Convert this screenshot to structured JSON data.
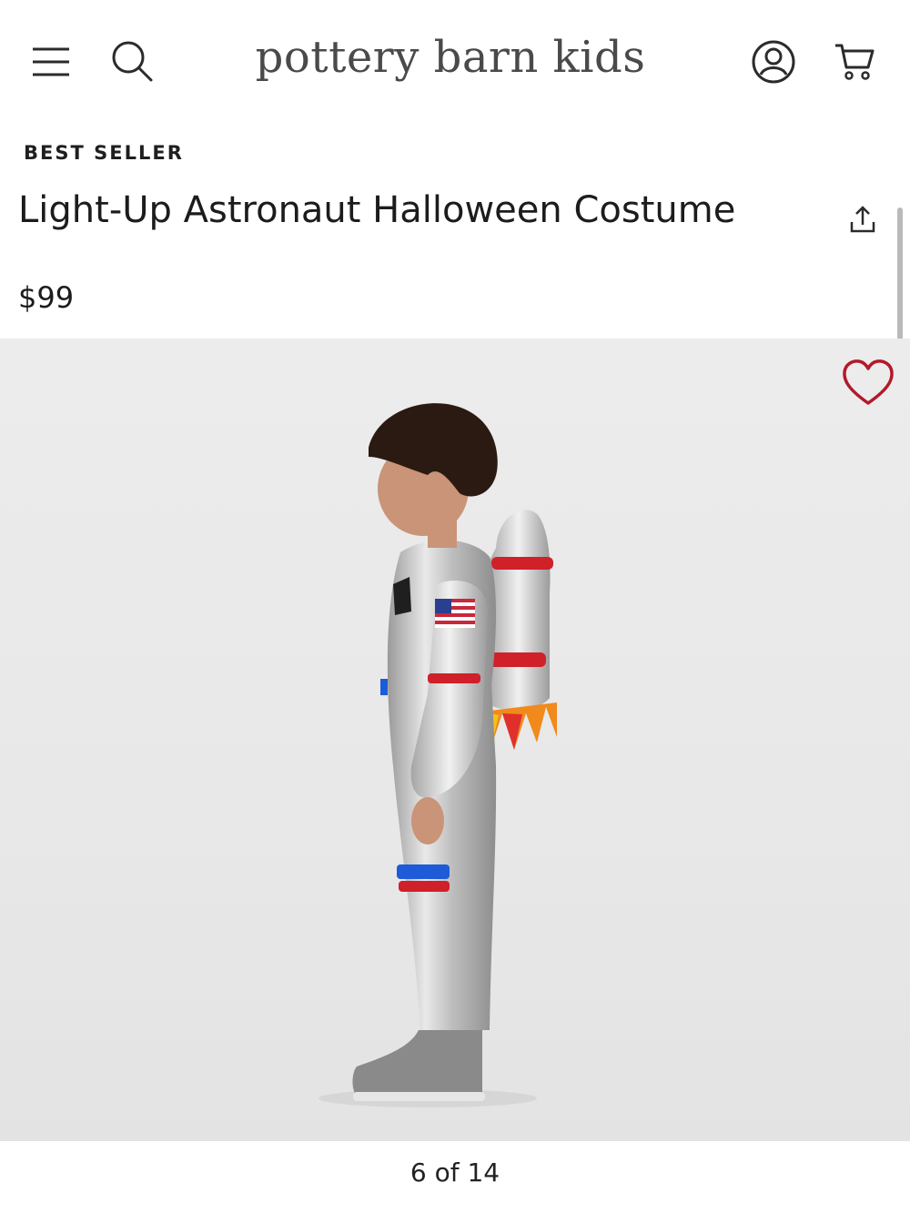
{
  "header": {
    "brand": "pottery barn kids",
    "icons": {
      "menu": "menu-icon",
      "search": "search-icon",
      "account": "account-icon",
      "cart": "cart-icon"
    }
  },
  "product": {
    "badge": "BEST SELLER",
    "title": "Light-Up Astronaut Halloween Costume",
    "price": "$99",
    "share_icon": "share-icon",
    "wishlist_icon": "heart-icon"
  },
  "gallery": {
    "counter": "6 of 14",
    "current": 6,
    "total": 14
  },
  "colors": {
    "heart": "#b3192b",
    "brand_text": "#4a4a4a",
    "image_bg": "#eaeaea"
  }
}
